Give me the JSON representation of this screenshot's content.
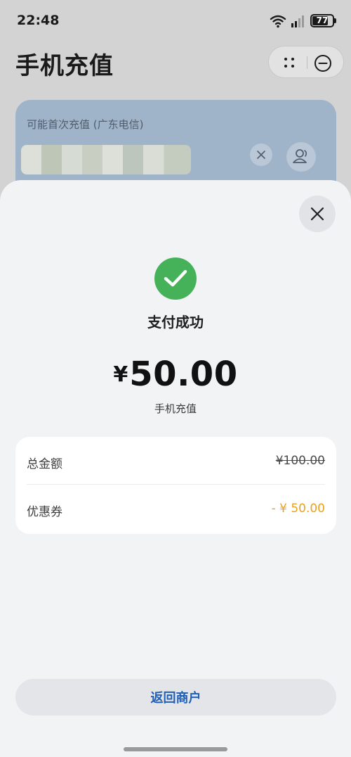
{
  "status": {
    "time": "22:48",
    "battery": "77",
    "battery_level": 0.77
  },
  "page": {
    "title": "手机充值",
    "card_label": "可能首次充值 (广东电信)"
  },
  "sheet": {
    "success_text": "支付成功",
    "currency_symbol": "¥",
    "amount": "50.00",
    "description": "手机充值",
    "details": [
      {
        "label": "总金额",
        "value": "¥100.00"
      },
      {
        "label": "优惠券",
        "value": "- ¥ 50.00"
      }
    ],
    "return_button": "返回商户"
  },
  "colors": {
    "success_green": "#45b25a",
    "discount_orange": "#e8a21e",
    "link_blue": "#1f5fb8"
  },
  "icons": [
    "wifi-icon",
    "signal-icon",
    "battery-icon",
    "more-dots-icon",
    "minus-circle-icon",
    "clear-icon",
    "contact-icon",
    "close-icon",
    "checkmark-icon"
  ]
}
